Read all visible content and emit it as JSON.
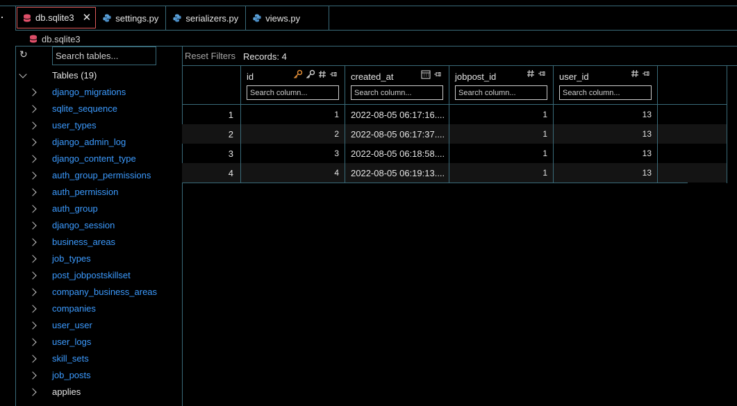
{
  "tabs": [
    {
      "label": "db.sqlite3",
      "icon": "database-icon",
      "active": true
    },
    {
      "label": "settings.py",
      "icon": "python-icon",
      "active": false
    },
    {
      "label": "serializers.py",
      "icon": "python-icon",
      "active": false
    },
    {
      "label": "views.py",
      "icon": "python-icon",
      "active": false
    }
  ],
  "close_glyph": "✕",
  "breadcrumb": {
    "label": "db.sqlite3"
  },
  "search_tables": {
    "placeholder": "Search tables..."
  },
  "refresh_glyph": "↻",
  "tree": {
    "root_label": "Tables (19)",
    "items": [
      "django_migrations",
      "sqlite_sequence",
      "user_types",
      "django_admin_log",
      "django_content_type",
      "auth_group_permissions",
      "auth_permission",
      "auth_group",
      "django_session",
      "business_areas",
      "job_types",
      "post_jobpostskillset",
      "company_business_areas",
      "companies",
      "user_user",
      "user_logs",
      "skill_sets",
      "job_posts",
      "applies"
    ]
  },
  "toolbar": {
    "reset_label": "Reset Filters",
    "records_label": "Records: 4"
  },
  "columns": [
    {
      "name": "id",
      "placeholder": "Search column..."
    },
    {
      "name": "created_at",
      "placeholder": "Search column..."
    },
    {
      "name": "jobpost_id",
      "placeholder": "Search column..."
    },
    {
      "name": "user_id",
      "placeholder": "Search column..."
    }
  ],
  "rows": [
    {
      "rownum": "1",
      "id": "1",
      "created_at": "2022-08-05 06:17:16....",
      "jobpost_id": "1",
      "user_id": "13"
    },
    {
      "rownum": "2",
      "id": "2",
      "created_at": "2022-08-05 06:17:37....",
      "jobpost_id": "1",
      "user_id": "13"
    },
    {
      "rownum": "3",
      "id": "3",
      "created_at": "2022-08-05 06:18:58....",
      "jobpost_id": "1",
      "user_id": "13"
    },
    {
      "rownum": "4",
      "id": "4",
      "created_at": "2022-08-05 06:19:13....",
      "jobpost_id": "1",
      "user_id": "13"
    }
  ],
  "colors": {
    "accent_border": "#3a6b7a",
    "link": "#3c9bff",
    "active_tab": "#e05a5a",
    "key_icon": "#e8923a",
    "db_icon": "#e0506a",
    "py_icon": "#5aa0d8"
  }
}
